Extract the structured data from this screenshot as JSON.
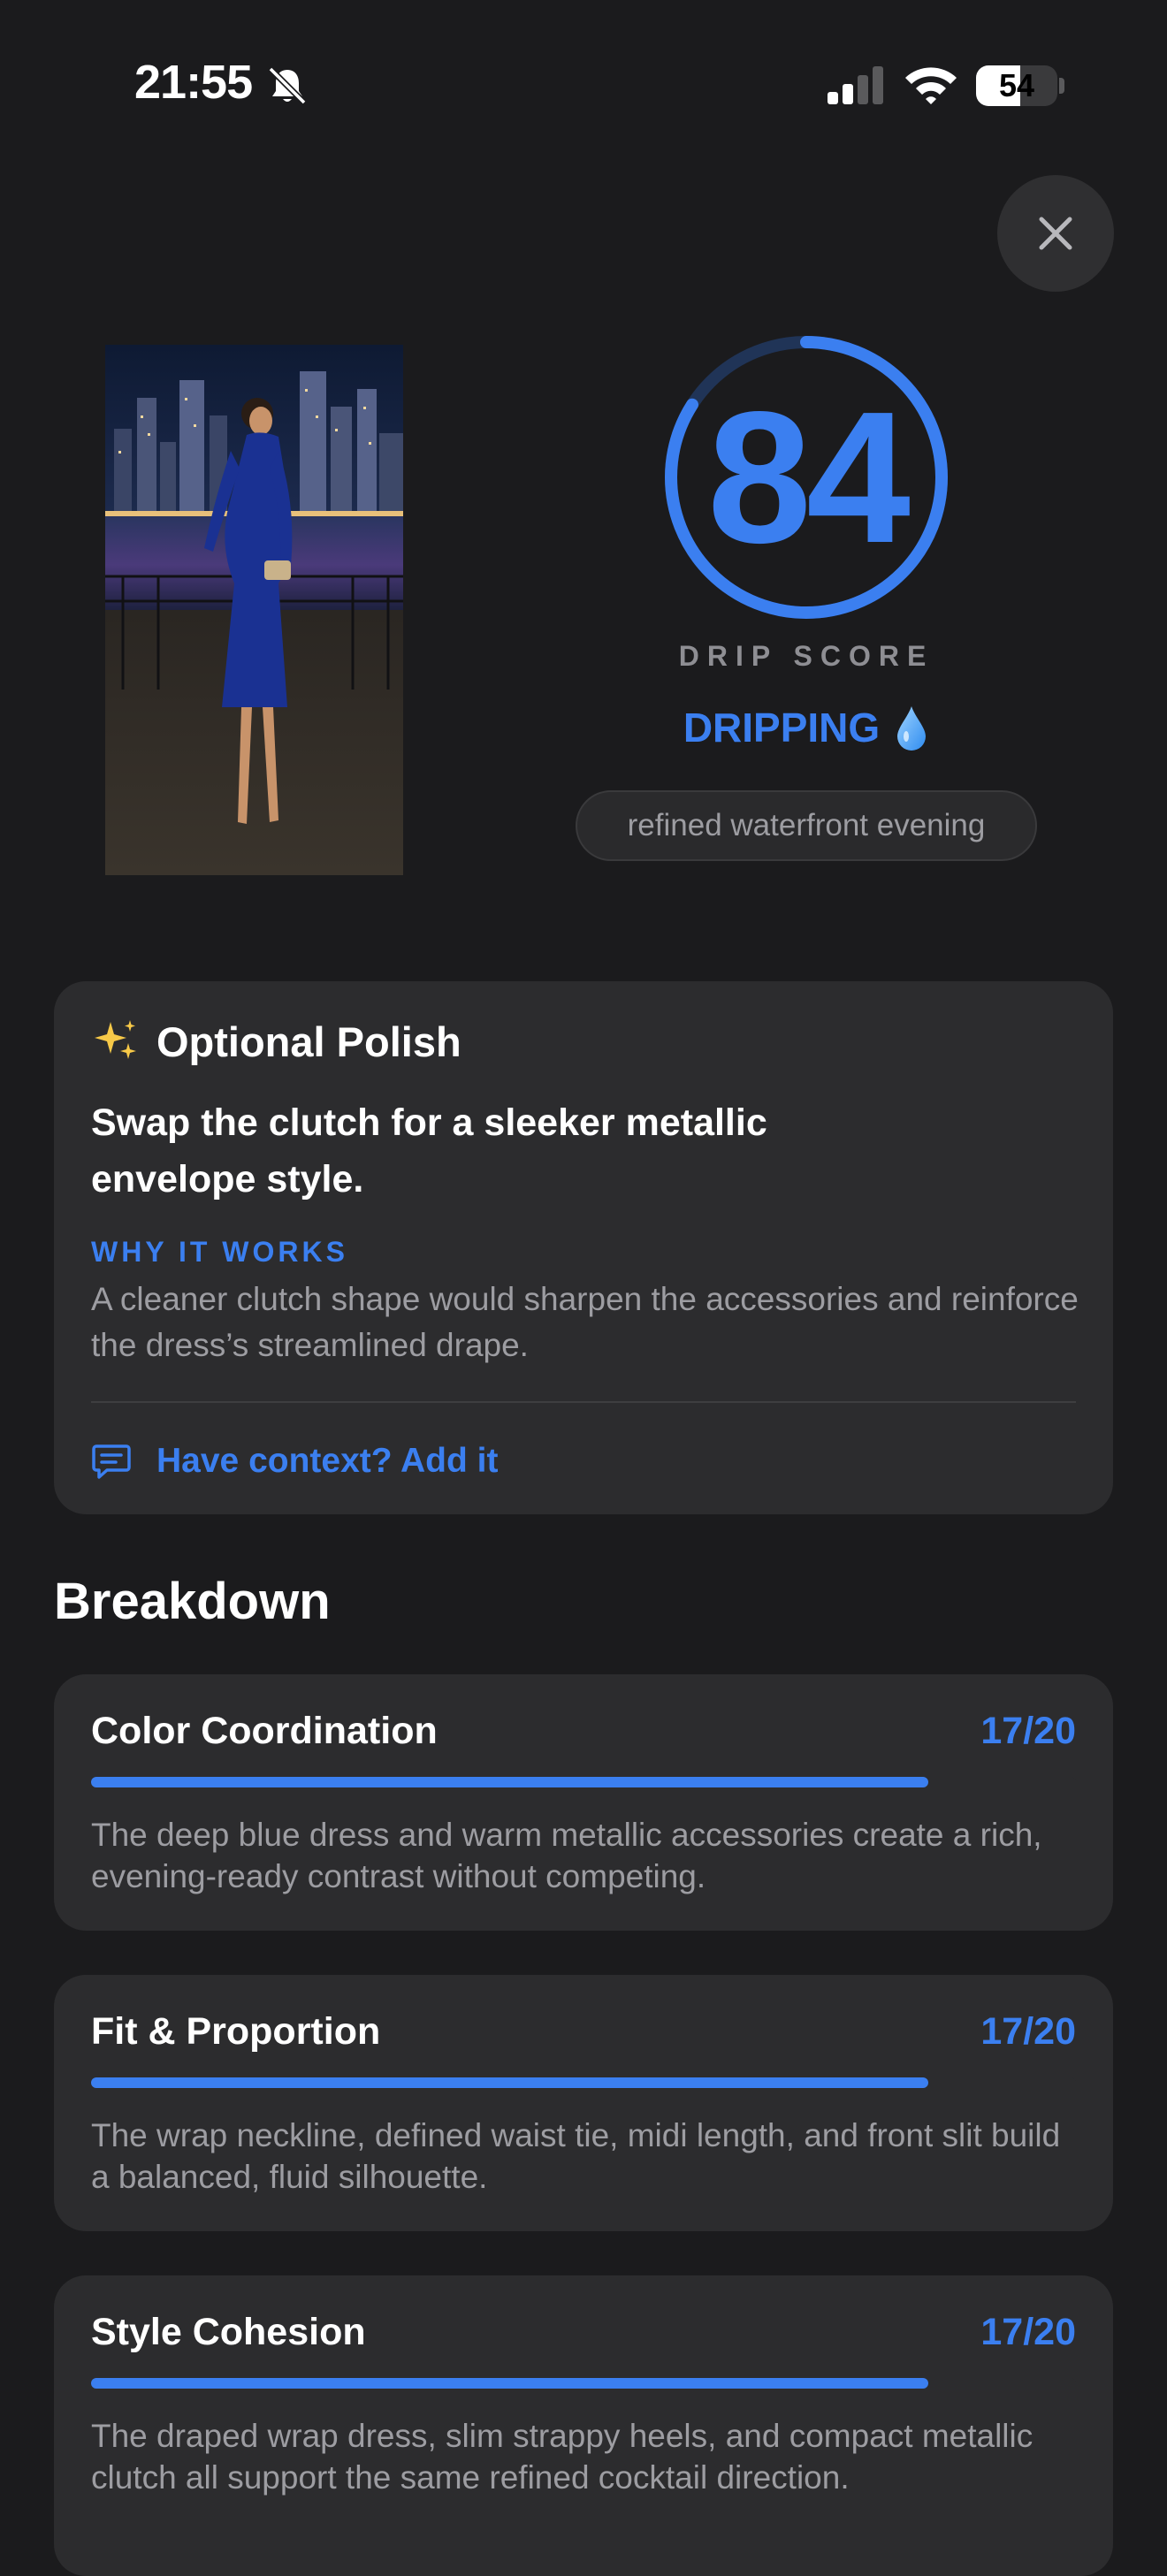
{
  "status_bar": {
    "time": "21:55",
    "battery_level": "54",
    "battery_fraction": 0.54
  },
  "icons": {
    "silent": "bell-slash-icon",
    "signal": "cellular-signal-icon",
    "wifi": "wifi-icon",
    "close": "close-icon",
    "sparkles": "sparkles-icon",
    "droplet": "droplet-icon",
    "comment": "comment-icon"
  },
  "score": {
    "value": "84",
    "max": 100,
    "label": "DRIP SCORE",
    "verdict": "DRIPPING",
    "vibe": "refined waterfront evening"
  },
  "polish": {
    "title": "Optional Polish",
    "suggestion": "Swap the clutch for a sleeker metallic envelope style.",
    "why_label": "WHY IT WORKS",
    "why_text": "A cleaner clutch shape would sharpen the accessories and reinforce the dress’s streamlined drape.",
    "context_link": "Have context? Add it"
  },
  "breakdown": {
    "title": "Breakdown",
    "items": [
      {
        "name": "Color Coordination",
        "score": "17/20",
        "fraction": 0.85,
        "text": "The deep blue dress and warm metallic accessories create a rich, evening-ready contrast without competing."
      },
      {
        "name": "Fit & Proportion",
        "score": "17/20",
        "fraction": 0.85,
        "text": "The wrap neckline, defined waist tie, midi length, and front slit build a balanced, fluid silhouette."
      },
      {
        "name": "Style Cohesion",
        "score": "17/20",
        "fraction": 0.85,
        "text": "The draped wrap dress, slim strappy heels, and compact metallic clutch all support the same refined cocktail direction."
      }
    ]
  },
  "colors": {
    "accent": "#3b7ff0",
    "background": "#1b1b1d",
    "card": "#2c2c2e",
    "muted_text": "#9d9da2"
  }
}
